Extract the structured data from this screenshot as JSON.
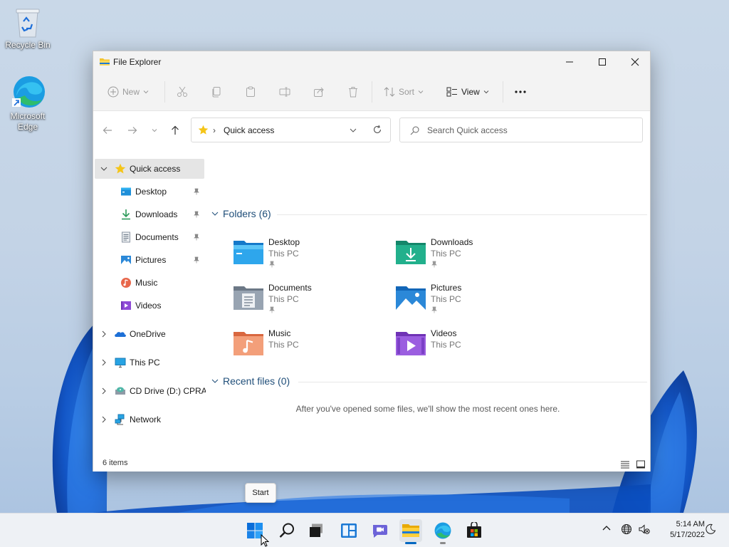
{
  "desktop": {
    "icons": [
      {
        "label": "Recycle Bin",
        "icon": "recycle-bin-icon"
      },
      {
        "label": "Microsoft Edge",
        "icon": "edge-icon"
      }
    ]
  },
  "window": {
    "title": "File Explorer",
    "controls": {
      "minimize": "minimize-icon",
      "maximize": "maximize-icon",
      "close": "close-icon"
    }
  },
  "toolbar": {
    "new_label": "New",
    "sort_label": "Sort",
    "view_label": "View",
    "more_icon": "more-icon",
    "disabled_actions": [
      "cut-icon",
      "copy-icon",
      "paste-icon",
      "rename-icon",
      "share-icon",
      "delete-icon"
    ]
  },
  "address": {
    "location": "Quick access",
    "search_placeholder": "Search Quick access"
  },
  "nav_pane": {
    "quick_access": "Quick access",
    "quick_items": [
      {
        "label": "Desktop",
        "pinned": true
      },
      {
        "label": "Downloads",
        "pinned": true
      },
      {
        "label": "Documents",
        "pinned": true
      },
      {
        "label": "Pictures",
        "pinned": true
      },
      {
        "label": "Music",
        "pinned": false
      },
      {
        "label": "Videos",
        "pinned": false
      }
    ],
    "roots": [
      {
        "label": "OneDrive"
      },
      {
        "label": "This PC"
      },
      {
        "label": "CD Drive (D:) CPRA_"
      },
      {
        "label": "Network"
      }
    ]
  },
  "content": {
    "folders_header": "Folders (6)",
    "folders": [
      {
        "name": "Desktop",
        "location": "This PC",
        "pinned": true
      },
      {
        "name": "Downloads",
        "location": "This PC",
        "pinned": true
      },
      {
        "name": "Documents",
        "location": "This PC",
        "pinned": true
      },
      {
        "name": "Pictures",
        "location": "This PC",
        "pinned": true
      },
      {
        "name": "Music",
        "location": "This PC",
        "pinned": false
      },
      {
        "name": "Videos",
        "location": "This PC",
        "pinned": false
      }
    ],
    "recent_header": "Recent files (0)",
    "recent_empty_message": "After you've opened some files, we'll show the most recent ones here."
  },
  "status": {
    "item_count": "6 items"
  },
  "tooltip": "Start",
  "taskbar": {
    "apps": [
      "start-icon",
      "search-icon",
      "task-view-icon",
      "widgets-icon",
      "chat-icon",
      "file-explorer-icon",
      "edge-icon",
      "store-icon"
    ],
    "time": "5:14 AM",
    "date": "5/17/2022"
  },
  "colors": {
    "accent": "#0067c0",
    "header_text": "#1f4e79",
    "taskbar": "#eef1f5"
  }
}
